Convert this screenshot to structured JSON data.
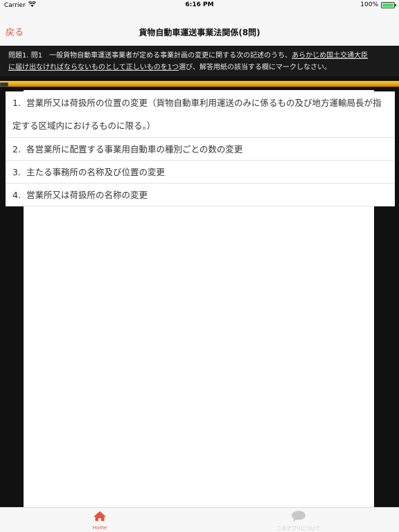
{
  "status": {
    "carrier": "Carrier",
    "time": "6:16 PM",
    "battery": "100%",
    "battery_level": 1.0
  },
  "nav": {
    "back_label": "戻る",
    "title": "貨物自動車運送事業法関係(8問)"
  },
  "question": {
    "prefix": "問題1. 問1　一般貨物自動車運送事業者が定める事業計画の変更に関する次の記述のうち、",
    "underlined_1": "あらかじめ国土交通大臣",
    "underlined_2": "に届け出なければならないものとして正しいものを1つ",
    "suffix": "選び、解答用紙の該当する欄にマークしなさい。"
  },
  "progress": {
    "value": 1.0
  },
  "answers": [
    {
      "num": "1.",
      "text": "営業所又は荷扱所の位置の変更（貨物自動車利用運送のみに係るもの及び地方運輸局長が指定する区域内におけるものに限る。）"
    },
    {
      "num": "2.",
      "text": "各営業所に配置する事業用自動車の種別ごとの数の変更"
    },
    {
      "num": "3.",
      "text": "主たる事務所の名称及び位置の変更"
    },
    {
      "num": "4.",
      "text": "営業所又は荷扱所の名称の変更"
    }
  ],
  "tabs": {
    "home": {
      "label": "Home",
      "icon": "home-icon",
      "color": "#e8533a"
    },
    "about": {
      "label": "このアプリについて",
      "icon": "speech-bubble-icon",
      "color": "#c8c8c8"
    }
  },
  "colors": {
    "accent": "#e8533a",
    "progress": "#f0b400"
  }
}
